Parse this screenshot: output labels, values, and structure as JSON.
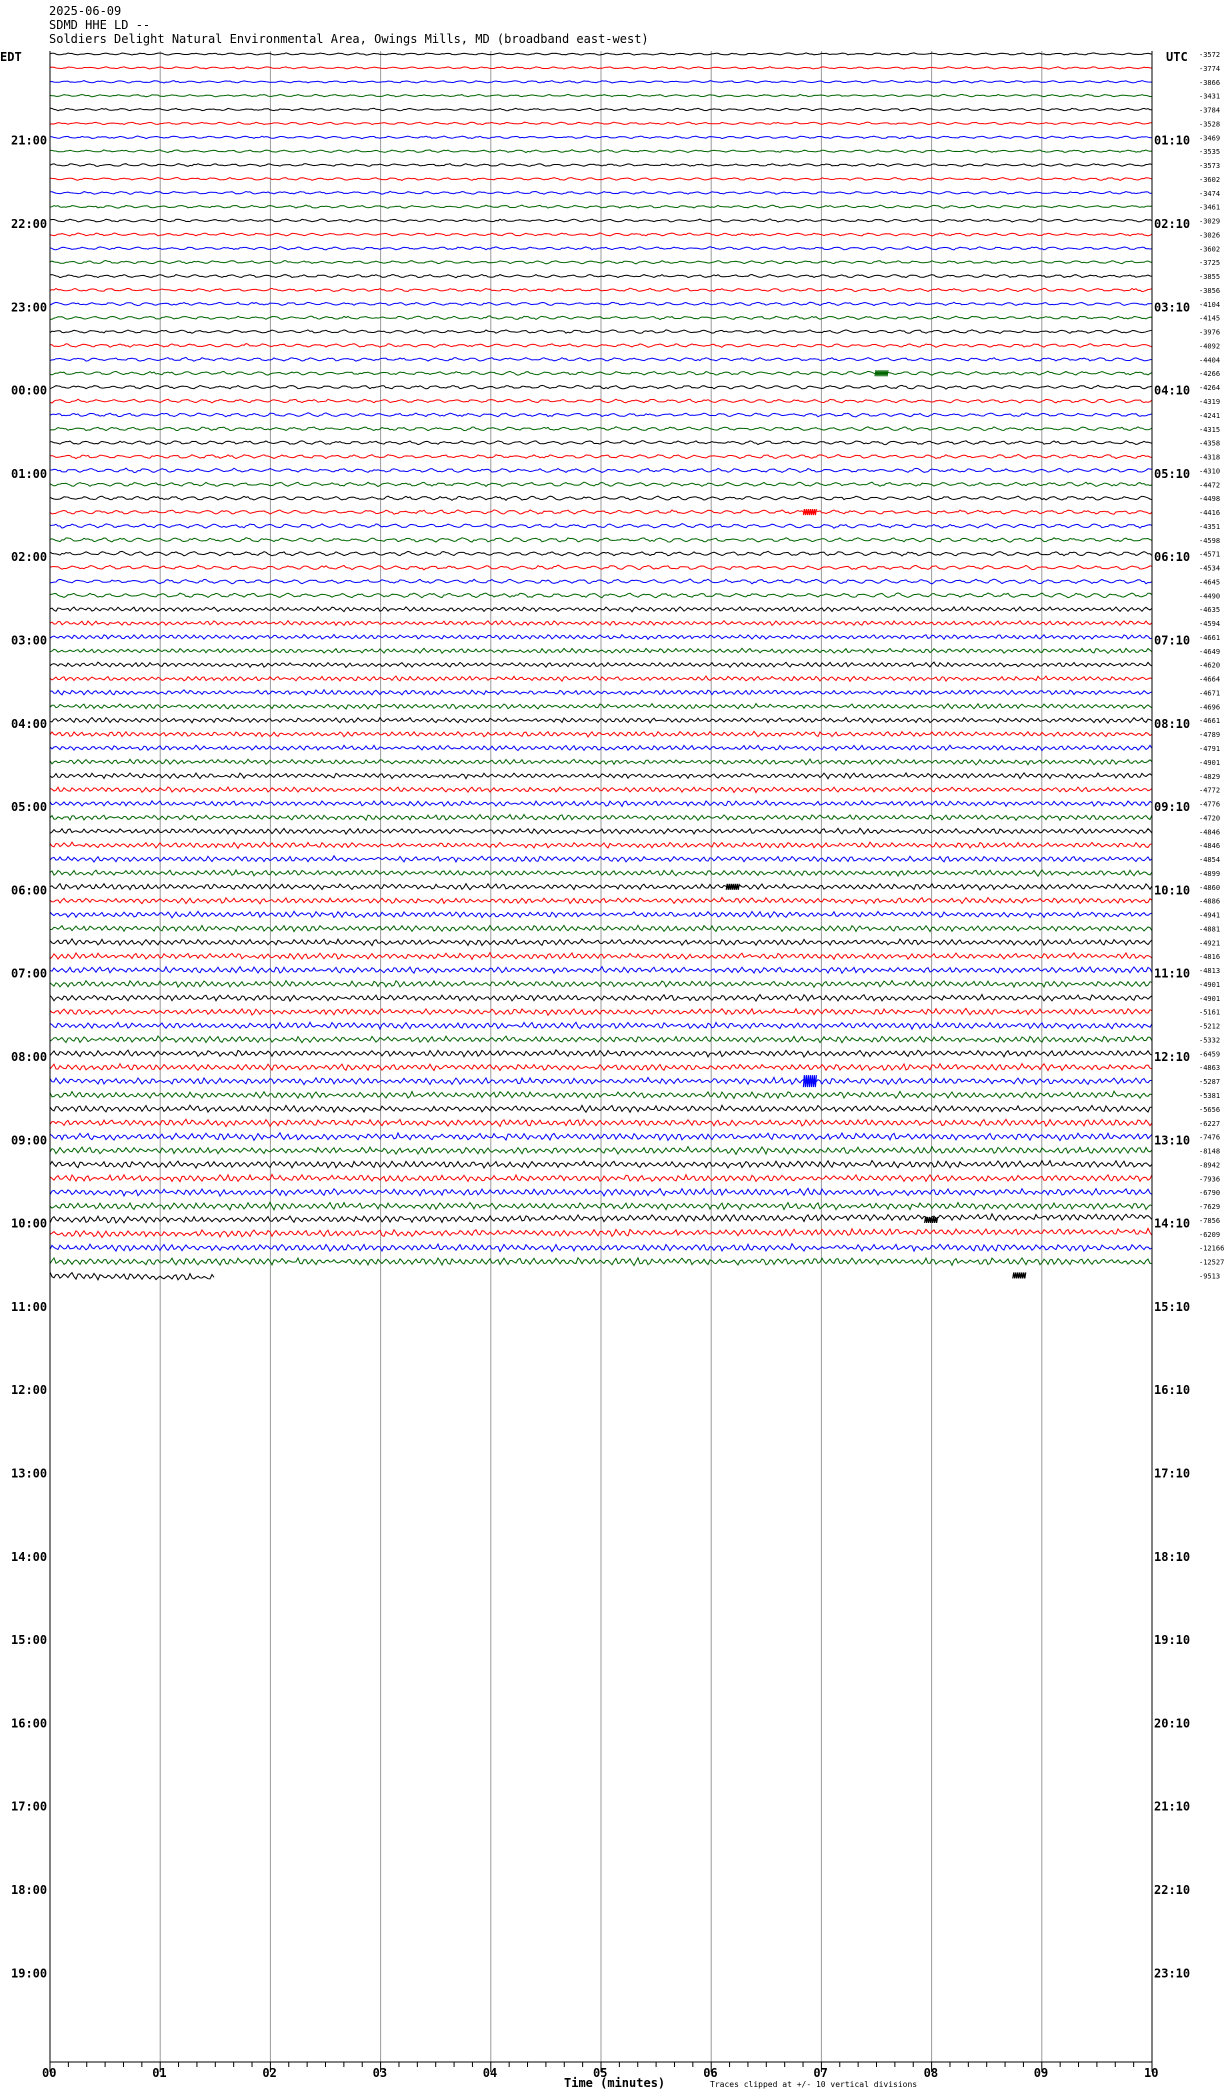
{
  "header": {
    "date": "2025-06-09",
    "station": "SDMD HHE LD --",
    "location": "Soldiers Delight Natural Environmental Area, Owings Mills, MD (broadband east-west)"
  },
  "left_axis_label": "EDT",
  "right_axis_label": "UTC",
  "xlabel": "Time (minutes)",
  "footnote": "Traces clipped at +/- 10 vertical divisions",
  "chart_data": {
    "type": "line",
    "title": "",
    "xlabel": "Time (minutes)",
    "xlim": [
      0,
      10
    ],
    "x_ticks": [
      "00",
      "01",
      "02",
      "03",
      "04",
      "05",
      "06",
      "07",
      "08",
      "09",
      "10"
    ],
    "left_hour_labels": [
      "21:00",
      "22:00",
      "23:00",
      "00:00",
      "01:00",
      "02:00",
      "03:00",
      "04:00",
      "05:00",
      "06:00",
      "07:00",
      "08:00",
      "09:00",
      "10:00",
      "11:00",
      "12:00",
      "13:00",
      "14:00",
      "15:00",
      "16:00",
      "17:00",
      "18:00",
      "19:00"
    ],
    "right_hour_labels": [
      "01:10",
      "02:10",
      "03:10",
      "04:10",
      "05:10",
      "06:10",
      "07:10",
      "08:10",
      "09:10",
      "10:10",
      "11:10",
      "12:10",
      "13:10",
      "14:10",
      "15:10",
      "16:10",
      "17:10",
      "18:10",
      "19:10",
      "20:10",
      "21:10",
      "22:10",
      "23:10"
    ],
    "trace_colors": [
      "#000000",
      "#ff0000",
      "#0000ff",
      "#006400"
    ],
    "trace_offsets": [
      "-3572",
      "-3774",
      "-3866",
      "-3431",
      "-3784",
      "-3528",
      "-3469",
      "-3535",
      "-3573",
      "-3602",
      "-3474",
      "-3461",
      "-3029",
      "-3026",
      "-3602",
      "-3725",
      "-3855",
      "-3856",
      "-4104",
      "-4145",
      "-3976",
      "-4092",
      "-4404",
      "-4266",
      "-4264",
      "-4319",
      "-4241",
      "-4315",
      "-4358",
      "-4318",
      "-4310",
      "-4472",
      "-4498",
      "-4416",
      "-4351",
      "-4598",
      "-4571",
      "-4534",
      "-4645",
      "-4490",
      "-4635",
      "-4594",
      "-4661",
      "-4649",
      "-4620",
      "-4664",
      "-4671",
      "-4696",
      "-4661",
      "-4789",
      "-4791",
      "-4901",
      "-4829",
      "-4772",
      "-4776",
      "-4720",
      "-4846",
      "-4846",
      "-4854",
      "-4899",
      "-4860",
      "-4886",
      "-4941",
      "-4881",
      "-4921",
      "-4816",
      "-4813",
      "-4901",
      "-4901",
      "-5161",
      "-5212",
      "-5332",
      "-6459",
      "-4863",
      "-5287",
      "-5381",
      "-5656",
      "-6227",
      "-7476",
      "-8148",
      "-8942",
      "-7936",
      "-6790",
      "-7629",
      "-7856",
      "-6209",
      "-12166",
      "-12527",
      "-9513"
    ],
    "last_trace_end_minutes": 1.5,
    "events": [
      {
        "trace_index": 23,
        "minute": 7.55,
        "note": "small spike"
      },
      {
        "trace_index": 33,
        "minute": 6.9,
        "note": "small spike"
      },
      {
        "trace_index": 60,
        "minute": 6.2,
        "note": "local burst"
      },
      {
        "trace_index": 74,
        "minute": 6.9,
        "note": "burst"
      },
      {
        "trace_index": 84,
        "minute": 8.0,
        "note": "long-period drift"
      },
      {
        "trace_index": 88,
        "minute": 8.8,
        "note": "long-period swell"
      }
    ]
  }
}
